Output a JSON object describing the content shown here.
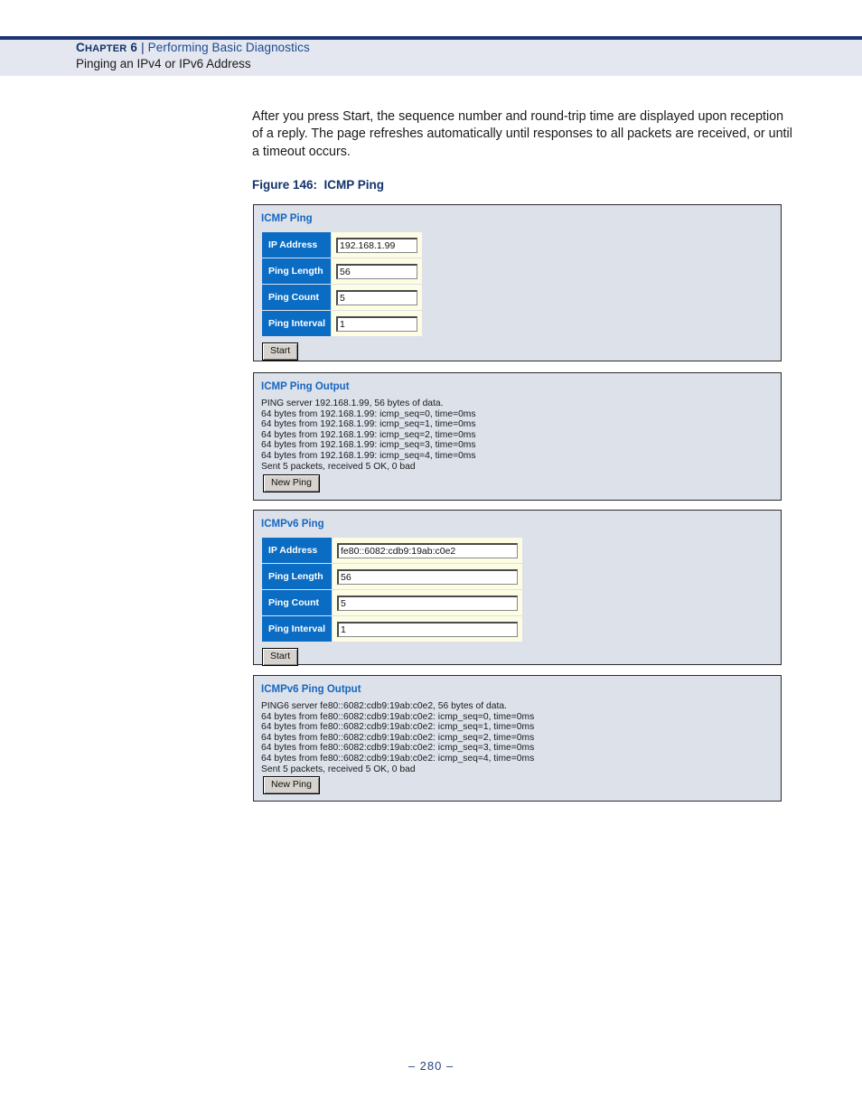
{
  "header": {
    "chapter_label": "Chapter 6",
    "separator": "|",
    "chapter_topic": "Performing Basic Diagnostics",
    "section_title": "Pinging an IPv4 or IPv6 Address",
    "rule_color": "#1c3572",
    "band_color": "#e4e7ef"
  },
  "body": {
    "paragraph": "After you press Start, the sequence number and round-trip time are displayed upon reception of a reply. The page refreshes automatically until responses to all packets are received, or until a timeout occurs.",
    "figure_caption": "Figure 146:  ICMP Ping"
  },
  "figure": {
    "panels": {
      "icmp_ping": {
        "title": "ICMP Ping",
        "fields": [
          {
            "label": "IP Address",
            "value": "192.168.1.99"
          },
          {
            "label": "Ping Length",
            "value": "56"
          },
          {
            "label": "Ping Count",
            "value": "5"
          },
          {
            "label": "Ping Interval",
            "value": "1"
          }
        ],
        "button": "Start"
      },
      "icmp_ping_output": {
        "title": "ICMP Ping Output",
        "lines": [
          "PING server 192.168.1.99, 56 bytes of data.",
          "64 bytes from 192.168.1.99: icmp_seq=0, time=0ms",
          "64 bytes from 192.168.1.99: icmp_seq=1, time=0ms",
          "64 bytes from 192.168.1.99: icmp_seq=2, time=0ms",
          "64 bytes from 192.168.1.99: icmp_seq=3, time=0ms",
          "64 bytes from 192.168.1.99: icmp_seq=4, time=0ms",
          "Sent 5 packets, received 5 OK, 0 bad"
        ],
        "log_text": "PING server 192.168.1.99, 56 bytes of data.\n64 bytes from 192.168.1.99: icmp_seq=0, time=0ms\n64 bytes from 192.168.1.99: icmp_seq=1, time=0ms\n64 bytes from 192.168.1.99: icmp_seq=2, time=0ms\n64 bytes from 192.168.1.99: icmp_seq=3, time=0ms\n64 bytes from 192.168.1.99: icmp_seq=4, time=0ms\nSent 5 packets, received 5 OK, 0 bad",
        "button": "New Ping"
      },
      "icmpv6_ping": {
        "title": "ICMPv6 Ping",
        "fields": [
          {
            "label": "IP Address",
            "value": "fe80::6082:cdb9:19ab:c0e2"
          },
          {
            "label": "Ping Length",
            "value": "56"
          },
          {
            "label": "Ping Count",
            "value": "5"
          },
          {
            "label": "Ping Interval",
            "value": "1"
          }
        ],
        "button": "Start"
      },
      "icmpv6_ping_output": {
        "title": "ICMPv6 Ping Output",
        "lines": [
          "PING6 server fe80::6082:cdb9:19ab:c0e2, 56 bytes of data.",
          "64 bytes from fe80::6082:cdb9:19ab:c0e2: icmp_seq=0, time=0ms",
          "64 bytes from fe80::6082:cdb9:19ab:c0e2: icmp_seq=1, time=0ms",
          "64 bytes from fe80::6082:cdb9:19ab:c0e2: icmp_seq=2, time=0ms",
          "64 bytes from fe80::6082:cdb9:19ab:c0e2: icmp_seq=3, time=0ms",
          "64 bytes from fe80::6082:cdb9:19ab:c0e2: icmp_seq=4, time=0ms",
          "Sent 5 packets, received 5 OK, 0 bad"
        ],
        "log_text": "PING6 server fe80::6082:cdb9:19ab:c0e2, 56 bytes of data.\n64 bytes from fe80::6082:cdb9:19ab:c0e2: icmp_seq=0, time=0ms\n64 bytes from fe80::6082:cdb9:19ab:c0e2: icmp_seq=1, time=0ms\n64 bytes from fe80::6082:cdb9:19ab:c0e2: icmp_seq=2, time=0ms\n64 bytes from fe80::6082:cdb9:19ab:c0e2: icmp_seq=3, time=0ms\n64 bytes from fe80::6082:cdb9:19ab:c0e2: icmp_seq=4, time=0ms\nSent 5 packets, received 5 OK, 0 bad",
        "button": "New Ping"
      }
    },
    "colors": {
      "panel_background": "#dce1ea",
      "panel_border": "#2b2b2b",
      "panel_title": "#1767c0",
      "label_cell": "#0b6cc4",
      "field_cell": "#fdfde3",
      "button_face": "#d6d3ce"
    }
  },
  "footer": {
    "page_number": "–  280  –"
  }
}
